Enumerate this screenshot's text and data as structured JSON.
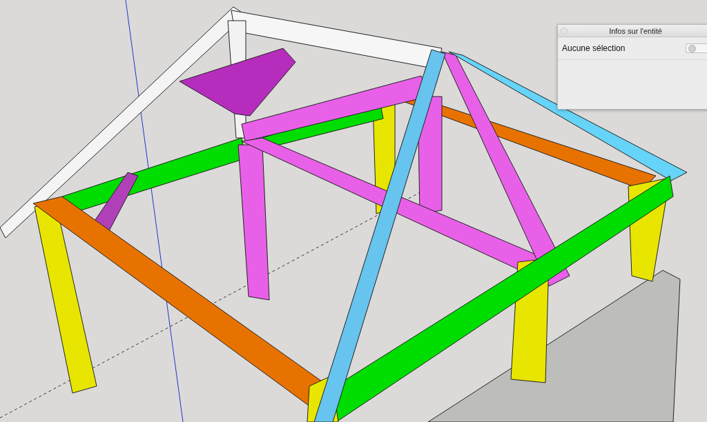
{
  "panel": {
    "title": "Infos sur l'entité",
    "selection_label": "Aucune sélection"
  }
}
